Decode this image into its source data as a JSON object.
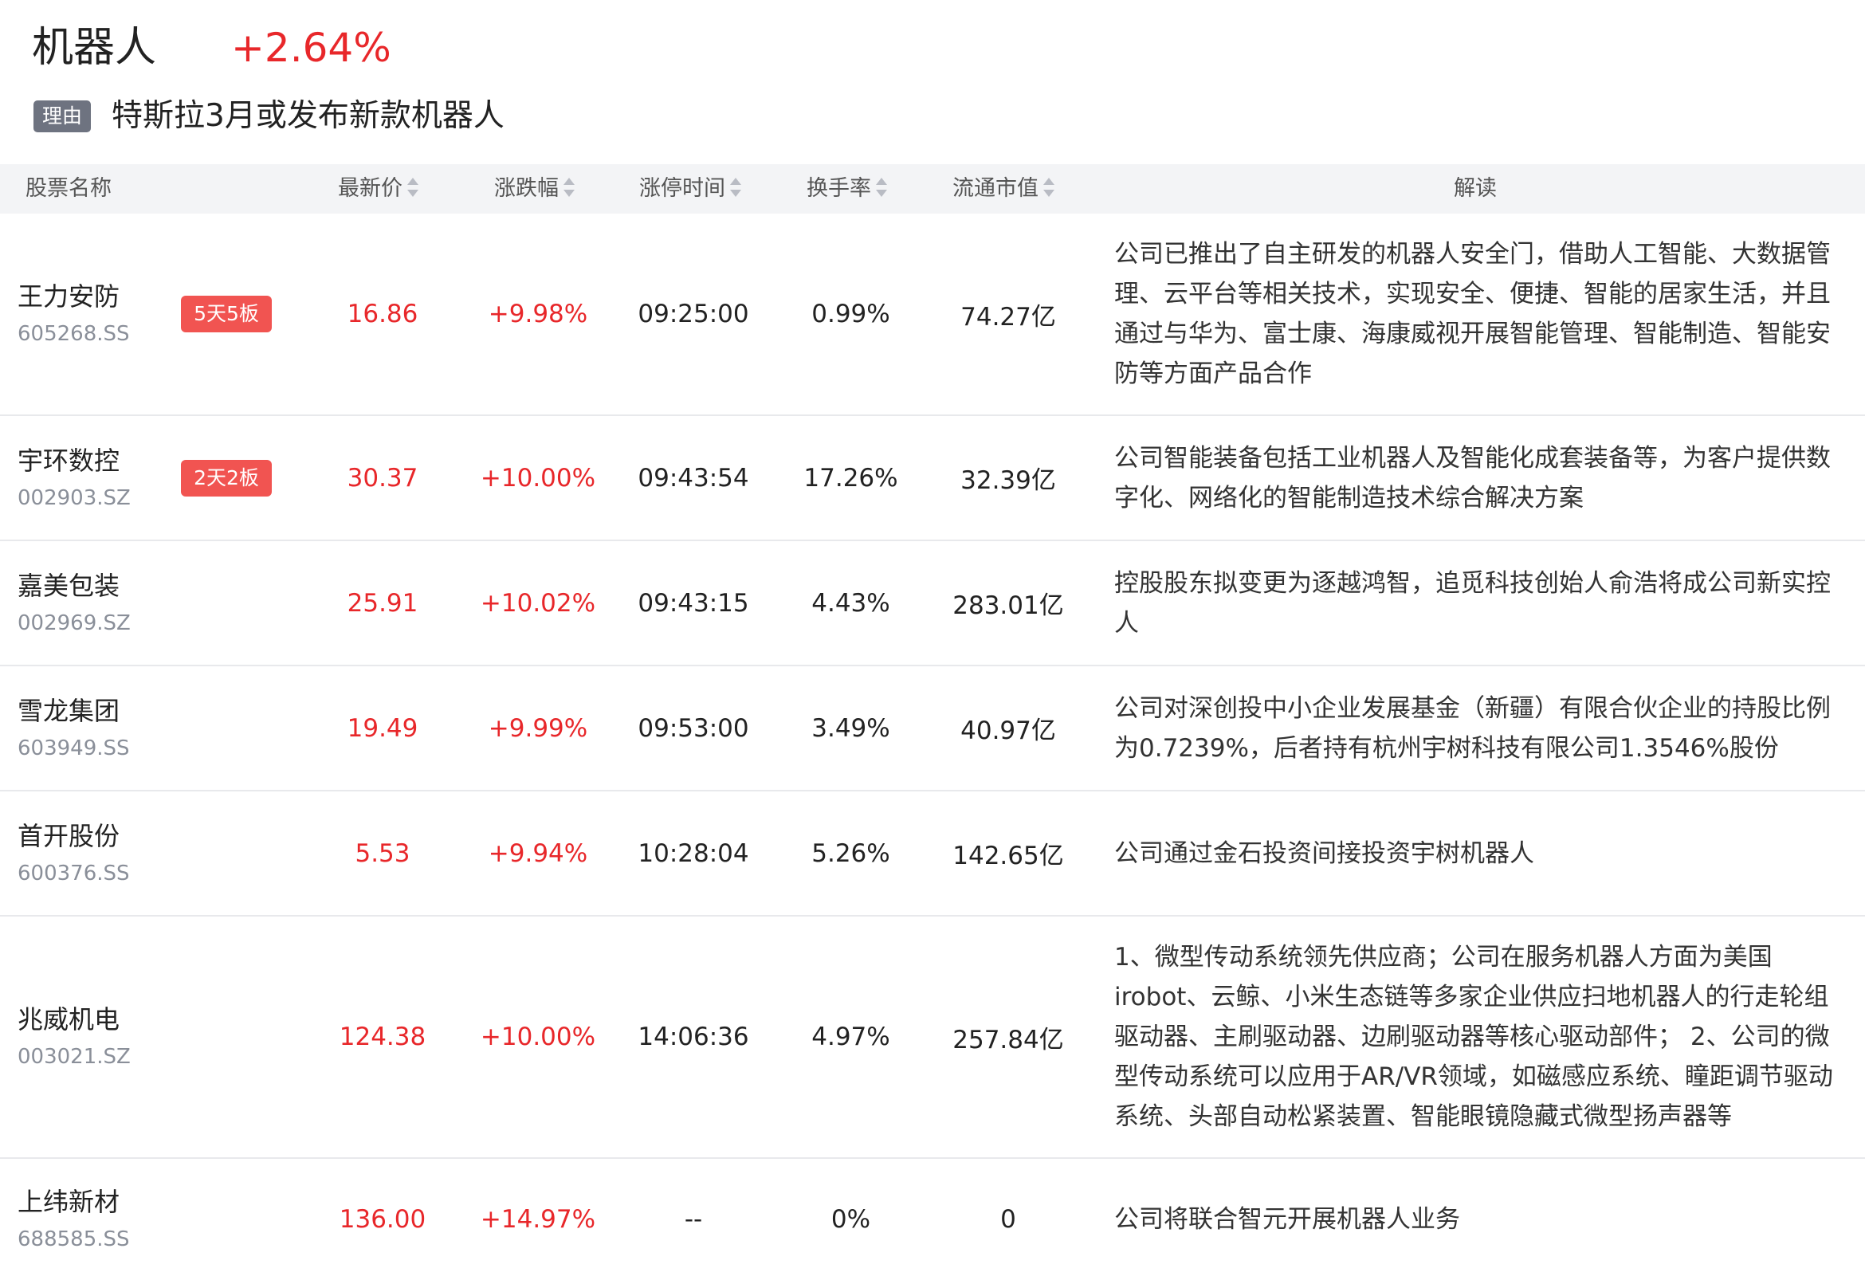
{
  "sector": {
    "name": "机器人",
    "change": "+2.64%",
    "reason_tag": "理由",
    "reason_text": "特斯拉3月或发布新款机器人"
  },
  "columns": {
    "name": "股票名称",
    "price": "最新价",
    "change": "涨跌幅",
    "limit_time": "涨停时间",
    "turnover": "换手率",
    "float_cap": "流通市值",
    "interpretation": "解读"
  },
  "rows": [
    {
      "name": "王力安防",
      "code": "605268.SS",
      "badge": "5天5板",
      "price": "16.86",
      "change": "+9.98%",
      "limit_time": "09:25:00",
      "turnover": "0.99%",
      "float_cap": "74.27亿",
      "interpretation": "公司已推出了自主研发的机器人安全门，借助人工智能、大数据管理、云平台等相关技术，实现安全、便捷、智能的居家生活，并且通过与华为、富士康、海康威视开展智能管理、智能制造、智能安防等方面产品合作"
    },
    {
      "name": "宇环数控",
      "code": "002903.SZ",
      "badge": "2天2板",
      "price": "30.37",
      "change": "+10.00%",
      "limit_time": "09:43:54",
      "turnover": "17.26%",
      "float_cap": "32.39亿",
      "interpretation": "公司智能装备包括工业机器人及智能化成套装备等，为客户提供数字化、网络化的智能制造技术综合解决方案"
    },
    {
      "name": "嘉美包装",
      "code": "002969.SZ",
      "badge": "",
      "price": "25.91",
      "change": "+10.02%",
      "limit_time": "09:43:15",
      "turnover": "4.43%",
      "float_cap": "283.01亿",
      "interpretation": "控股股东拟变更为逐越鸿智，追觅科技创始人俞浩将成公司新实控人"
    },
    {
      "name": "雪龙集团",
      "code": "603949.SS",
      "badge": "",
      "price": "19.49",
      "change": "+9.99%",
      "limit_time": "09:53:00",
      "turnover": "3.49%",
      "float_cap": "40.97亿",
      "interpretation": "公司对深创投中小企业发展基金（新疆）有限合伙企业的持股比例为0.7239%，后者持有杭州宇树科技有限公司1.3546%股份"
    },
    {
      "name": "首开股份",
      "code": "600376.SS",
      "badge": "",
      "price": "5.53",
      "change": "+9.94%",
      "limit_time": "10:28:04",
      "turnover": "5.26%",
      "float_cap": "142.65亿",
      "interpretation": "公司通过金石投资间接投资宇树机器人"
    },
    {
      "name": "兆威机电",
      "code": "003021.SZ",
      "badge": "",
      "price": "124.38",
      "change": "+10.00%",
      "limit_time": "14:06:36",
      "turnover": "4.97%",
      "float_cap": "257.84亿",
      "interpretation": "1、微型传动系统领先供应商；公司在服务机器人方面为美国irobot、云鲸、小米生态链等多家企业供应扫地机器人的行走轮组驱动器、主刷驱动器、边刷驱动器等核心驱动部件； 2、公司的微型传动系统可以应用于AR/VR领域，如磁感应系统、瞳距调节驱动系统、头部自动松紧装置、智能眼镜隐藏式微型扬声器等"
    },
    {
      "name": "上纬新材",
      "code": "688585.SS",
      "badge": "",
      "price": "136.00",
      "change": "+14.97%",
      "limit_time": "--",
      "turnover": "0%",
      "float_cap": "0",
      "interpretation": "公司将联合智元开展机器人业务"
    }
  ]
}
